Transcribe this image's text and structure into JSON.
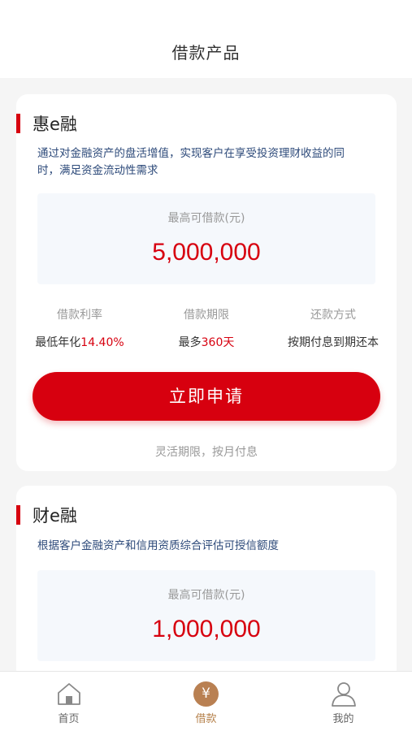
{
  "header": {
    "title": "借款产品"
  },
  "products": [
    {
      "name": "惠e融",
      "description": "通过对金融资产的盘活增值，实现客户在享受投资理财收益的同时，满足资金流动性需求",
      "amount_label": "最高可借款(元)",
      "amount": "5,000,000",
      "terms": [
        {
          "label": "借款利率",
          "prefix": "最低年化",
          "highlight": "14.40%",
          "suffix": ""
        },
        {
          "label": "借款期限",
          "prefix": "最多",
          "highlight": "360天",
          "suffix": ""
        },
        {
          "label": "还款方式",
          "prefix": "按期付息到期还本",
          "highlight": "",
          "suffix": ""
        }
      ],
      "apply_label": "立即申请",
      "note": "灵活期限，按月付息"
    },
    {
      "name": "财e融",
      "description": "根据客户金融资产和信用资质综合评估可授信额度",
      "amount_label": "最高可借款(元)",
      "amount": "1,000,000"
    }
  ],
  "tabbar": {
    "items": [
      {
        "label": "首页",
        "icon": "home-icon",
        "active": false
      },
      {
        "label": "借款",
        "icon": "yuan-icon",
        "active": true
      },
      {
        "label": "我的",
        "icon": "user-icon",
        "active": false
      }
    ],
    "loan_glyph": "¥"
  },
  "colors": {
    "accent": "#d7000f",
    "active_tab": "#b5804a",
    "desc_text": "#2d4a7a"
  }
}
